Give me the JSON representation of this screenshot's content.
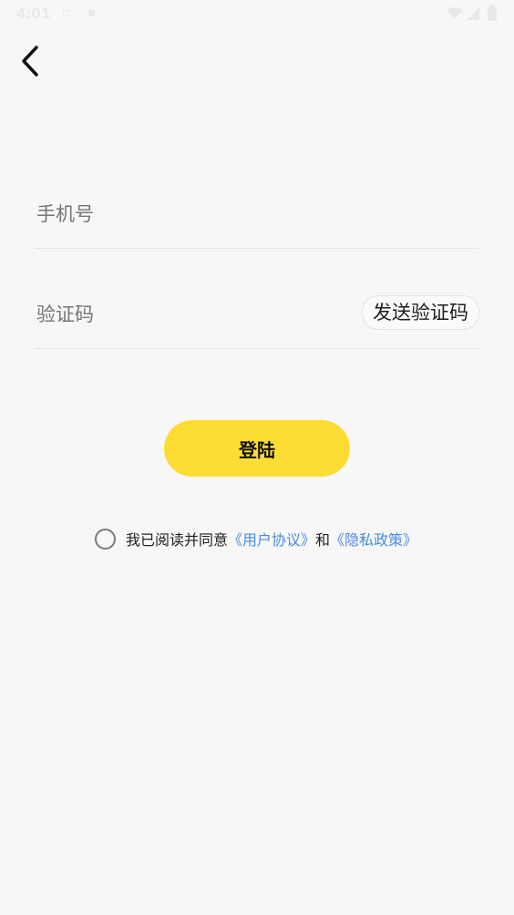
{
  "statusbar": {
    "time": "4:01",
    "icons": [
      "notification-icon",
      "sd-card-icon",
      "wifi-icon",
      "signal-icon",
      "battery-icon"
    ]
  },
  "nav": {
    "back_icon": "chevron-left-icon"
  },
  "form": {
    "phone_placeholder": "手机号",
    "code_placeholder": "验证码",
    "send_code_label": "发送验证码"
  },
  "login": {
    "label": "登陆",
    "color": "#fddc34"
  },
  "agreement": {
    "prefix": "我已阅读并同意",
    "user_agreement": "《用户协议》",
    "and": "和",
    "privacy_policy": "《隐私政策》",
    "link_color": "#4a8be0"
  }
}
